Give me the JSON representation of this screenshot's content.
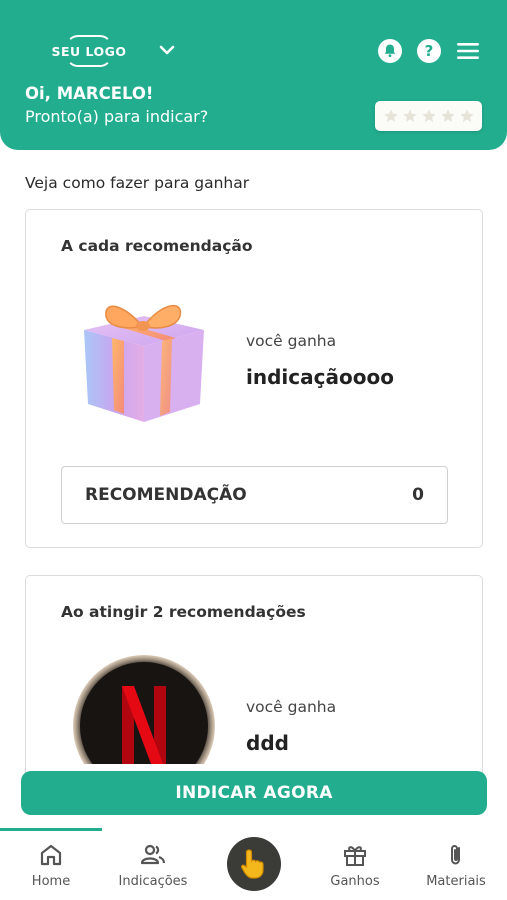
{
  "header": {
    "logo_text": "SEU LOGO",
    "greeting": "Oi, MARCELO!",
    "subtitle": "Pronto(a) para indicar?",
    "rating": {
      "filled": 0,
      "total": 5
    },
    "icons": [
      "chevron-down-icon",
      "bell-icon",
      "help-icon",
      "menu-icon"
    ]
  },
  "main": {
    "section_title": "Veja como fazer para ganhar",
    "cards": [
      {
        "title": "A cada recomendação",
        "prize_label": "você ganha",
        "prize_value": "indicaçãoooo",
        "image": "gift-box",
        "counter": {
          "label": "RECOMENDAÇÃO",
          "value": "0"
        }
      },
      {
        "title": "Ao atingir 2 recomendações",
        "prize_label": "você ganha",
        "prize_value": "ddd",
        "image": "netflix-logo"
      }
    ]
  },
  "cta": {
    "label": "INDICAR AGORA"
  },
  "bottom_nav": {
    "items": [
      {
        "label": "Home",
        "icon": "home-icon",
        "active": true
      },
      {
        "label": "Indicações",
        "icon": "users-icon",
        "active": false
      },
      {
        "label": "",
        "icon": "pointing-hand-icon",
        "active": false
      },
      {
        "label": "Ganhos",
        "icon": "gift-icon",
        "active": false
      },
      {
        "label": "Materiais",
        "icon": "paperclip-icon",
        "active": false
      }
    ]
  },
  "colors": {
    "primary": "#22ad8f",
    "center_button": "#3b3b38",
    "hand": "#f5b81c"
  }
}
